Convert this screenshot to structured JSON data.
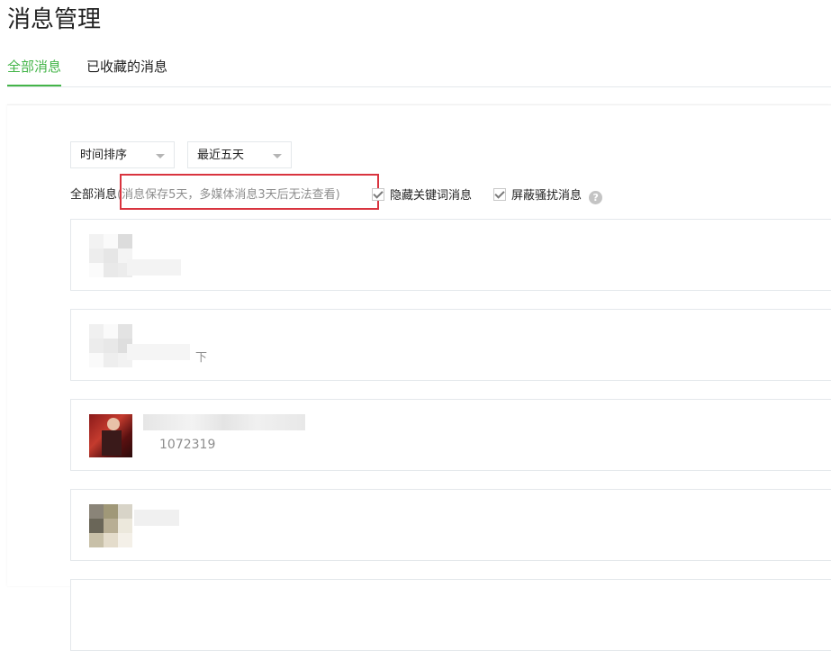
{
  "page": {
    "title": "消息管理"
  },
  "tabs": [
    {
      "label": "全部消息",
      "active": true
    },
    {
      "label": "已收藏的消息",
      "active": false
    }
  ],
  "filters": {
    "sort_select": "时间排序",
    "range_select": "最近五天",
    "all_label": "全部消息",
    "note": "(消息保存5天，多媒体消息3天后无法查看)",
    "hide_keyword_label": "隐藏关键词消息",
    "hide_keyword_checked": true,
    "block_harass_label": "屏蔽骚扰消息",
    "block_harass_checked": true,
    "help_icon": "question-circle-icon",
    "help_glyph": "?"
  },
  "messages": [
    {
      "text": ""
    },
    {
      "text": "下"
    },
    {
      "text": "1072319"
    },
    {
      "text": ""
    }
  ],
  "colors": {
    "accent": "#44b549",
    "highlight": "#d9343f",
    "border": "#e4e8eb",
    "muted_text": "#8d8d8d"
  }
}
